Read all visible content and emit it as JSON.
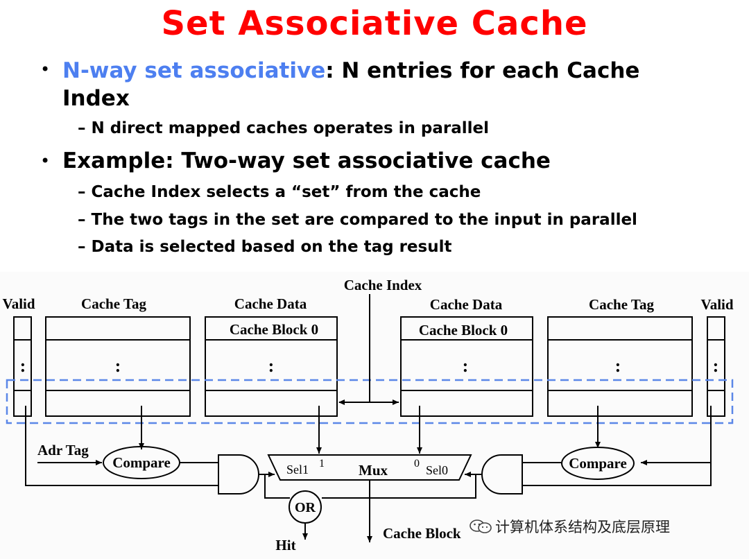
{
  "title": "Set Associative Cache",
  "bullets": {
    "b1_highlight": "N-way set associative",
    "b1_rest": ": N entries for each Cache Index",
    "b1_sub": "– N direct mapped caches operates in parallel",
    "b2": "Example: Two-way set associative cache",
    "b2_subs": [
      "– Cache Index selects a “set” from the cache",
      "– The two tags in the set are compared to the input in parallel",
      "– Data is selected based on the tag result"
    ]
  },
  "diagram": {
    "cache_index": "Cache Index",
    "left_valid": "Valid",
    "left_tag": "Cache Tag",
    "left_data": "Cache Data",
    "left_block": "Cache Block 0",
    "right_data": "Cache Data",
    "right_block": "Cache Block 0",
    "right_tag": "Cache Tag",
    "right_valid": "Valid",
    "ellipsis": ":",
    "adr_tag": "Adr Tag",
    "compare_left": "Compare",
    "compare_right": "Compare",
    "sel1": "Sel1",
    "sel1_num": "1",
    "mux": "Mux",
    "sel0_num": "0",
    "sel0": "Sel0",
    "or_gate": "OR",
    "hit": "Hit",
    "cache_block_out": "Cache Block"
  },
  "watermark": "计算机体系结构及底层原理",
  "colors": {
    "title": "#ff0000",
    "highlight": "#4d7ff0",
    "dashed_box": "#5b87e8"
  }
}
